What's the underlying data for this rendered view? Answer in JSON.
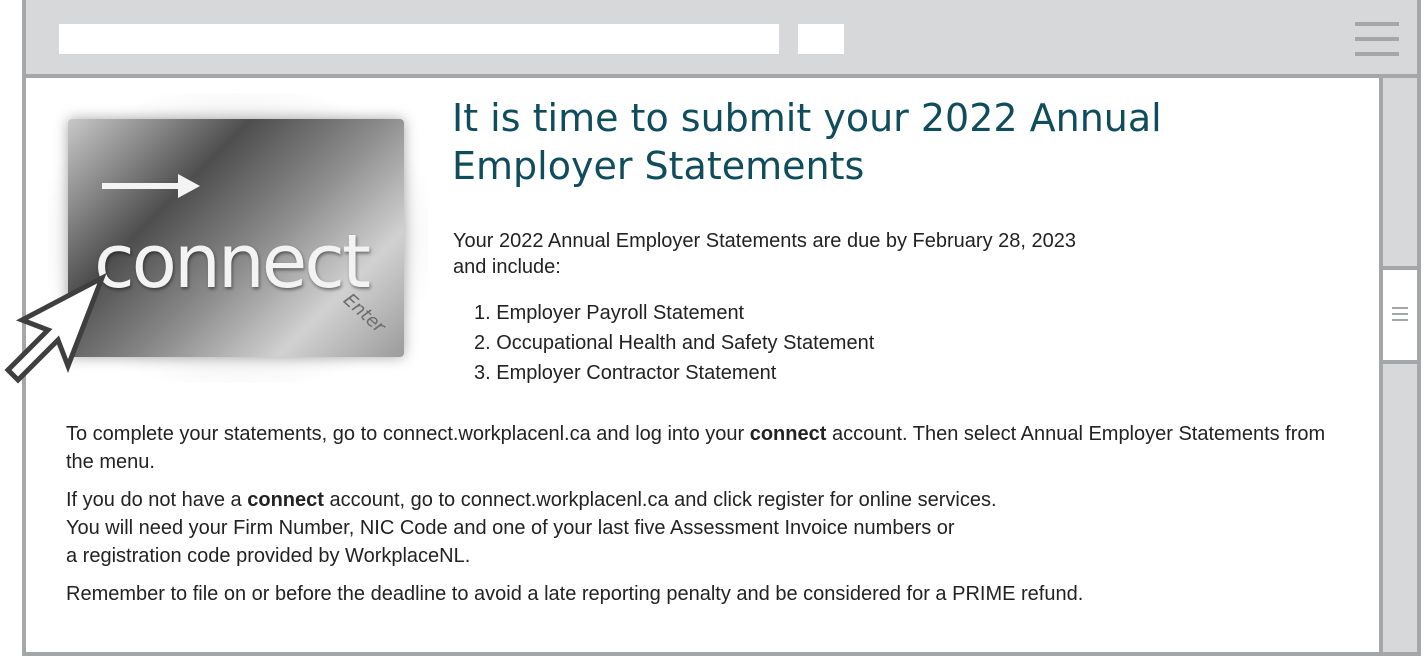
{
  "email": {
    "heading": "It is time to submit your 2022 Annual Employer Statements",
    "intro": "Your 2022 Annual Employer Statements are due by February 28, 2023 and include:",
    "statements": [
      "1.  Employer Payroll Statement",
      "2.  Occupational Health and Safety Statement",
      "3.  Employer Contractor Statement"
    ],
    "paragraph_1": {
      "before": "To complete your statements, go to connect.workplacenl.ca and log into your ",
      "bold": "connect",
      "after": " account. Then select Annual Employer Statements from the menu."
    },
    "paragraph_2": {
      "before": "If you do not have a ",
      "bold": "connect",
      "line_1_rest": " account, go to connect.workplacenl.ca and click register for online services.",
      "line_2": "You will need your Firm Number, NIC Code and one of your last five Assessment Invoice numbers or",
      "line_3": "a registration code provided by WorkplaceNL."
    },
    "paragraph_3": "Remember to file on or before the deadline to avoid a late reporting penalty and be considered for a PRIME refund."
  },
  "hero_image": {
    "main_word": "connect",
    "key_label": "Enter",
    "icons": [
      "arrow-right-icon",
      "cursor-arrow-icon"
    ]
  },
  "toolbar": {
    "icons": [
      "hamburger-menu-icon"
    ]
  },
  "colors": {
    "heading": "#0f4c5c",
    "frame": "#a5a6a8",
    "toolbar": "#d7d8da",
    "text": "#222222"
  }
}
